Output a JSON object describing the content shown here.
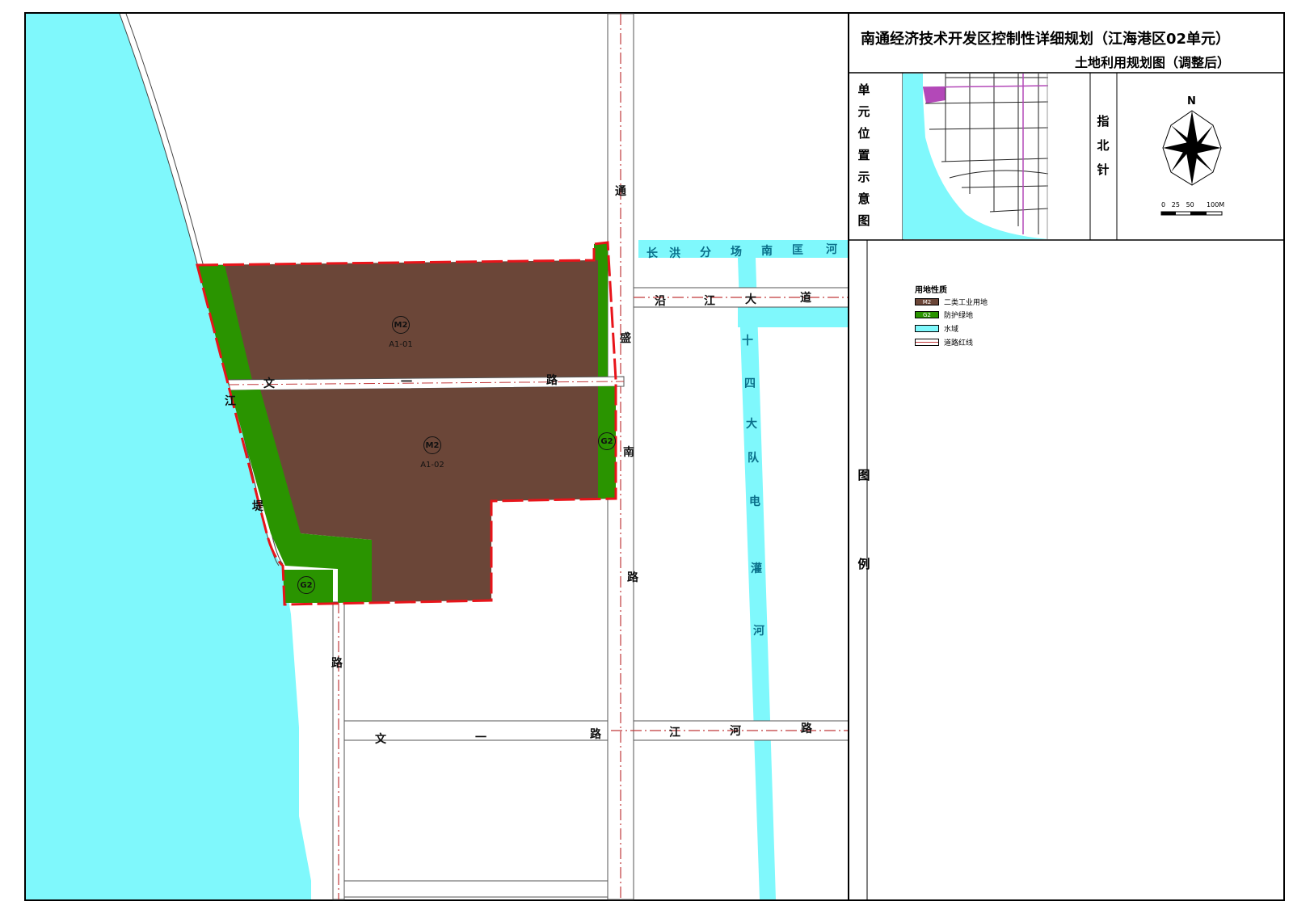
{
  "title": {
    "main": "南通经济技术开发区控制性详细规划（江海港区02单元）",
    "sub": "土地利用规划图（调整后）"
  },
  "sidebar": {
    "location_label": [
      "单",
      "元",
      "位",
      "置",
      "示",
      "意",
      "图"
    ],
    "north_label": [
      "指",
      "北",
      "针"
    ],
    "legend_label": [
      "图",
      "例"
    ]
  },
  "compass": {
    "north": "N",
    "scale_ticks": [
      "0",
      "25",
      "50",
      "100M"
    ]
  },
  "legend": {
    "title": "用地性质",
    "items": [
      {
        "code": "M2",
        "label": "二类工业用地",
        "color": "#6b4638"
      },
      {
        "code": "G2",
        "label": "防护绿地",
        "color": "#2a9400"
      },
      {
        "code": "",
        "label": "水域",
        "color": "#7ff8fc"
      },
      {
        "code": "",
        "label": "道路红线",
        "color": "#ffffff"
      }
    ]
  },
  "parcels": [
    {
      "type": "M2",
      "code": "A1-01"
    },
    {
      "type": "M2",
      "code": "A1-02"
    },
    {
      "type": "G2",
      "code": ""
    },
    {
      "type": "G2",
      "code": ""
    }
  ],
  "roads": {
    "tongsheng_south": [
      "通",
      "盛",
      "南",
      "路"
    ],
    "wenyi_upper": [
      "文",
      "一",
      "路"
    ],
    "yanjiang": [
      "沿",
      "江",
      "大",
      "道"
    ],
    "jiangdi": [
      "江",
      "堤",
      "路"
    ],
    "wenyi_lower": [
      "文",
      "一",
      "路"
    ],
    "jianghe": [
      "江",
      "河",
      "路"
    ]
  },
  "canals": {
    "changhong": [
      "长",
      "洪",
      "分",
      "场",
      "南",
      "匡",
      "河"
    ],
    "shisi": [
      "十",
      "四",
      "大",
      "队",
      "电",
      "灌",
      "河"
    ]
  },
  "colors": {
    "water": "#7ff8fc",
    "industrial": "#6b4638",
    "green": "#2a9400",
    "boundary": "#e8141a",
    "road_center": "#c0393b"
  }
}
